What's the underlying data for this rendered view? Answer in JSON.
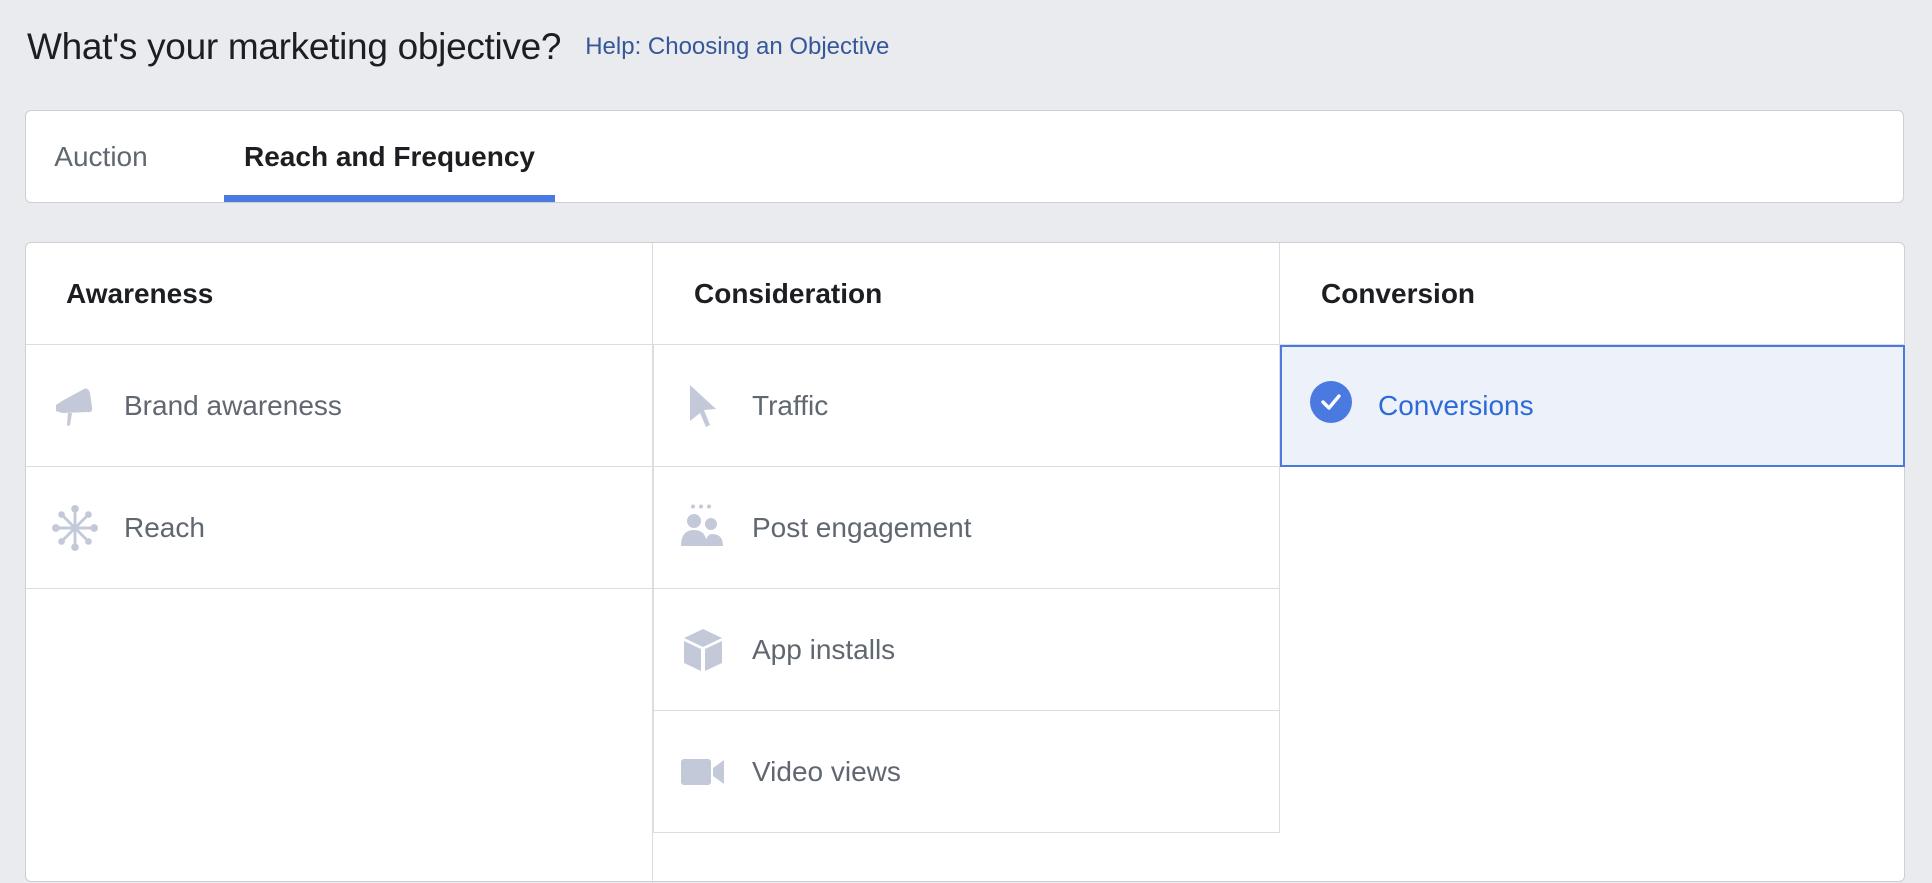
{
  "header": {
    "title": "What's your marketing objective?",
    "help_link": "Help: Choosing an Objective"
  },
  "tabs": [
    {
      "label": "Auction",
      "active": false
    },
    {
      "label": "Reach and Frequency",
      "active": true
    }
  ],
  "columns": [
    {
      "heading": "Awareness",
      "options": [
        {
          "label": "Brand awareness",
          "icon": "megaphone-icon"
        },
        {
          "label": "Reach",
          "icon": "reach-icon"
        }
      ]
    },
    {
      "heading": "Consideration",
      "options": [
        {
          "label": "Traffic",
          "icon": "cursor-icon"
        },
        {
          "label": "Post engagement",
          "icon": "people-icon"
        },
        {
          "label": "App installs",
          "icon": "box-icon"
        },
        {
          "label": "Video views",
          "icon": "video-camera-icon"
        }
      ]
    },
    {
      "heading": "Conversion",
      "options": [
        {
          "label": "Conversions",
          "icon": "check-circle-icon",
          "selected": true
        }
      ]
    }
  ],
  "colors": {
    "accent": "#4a7adf",
    "selected_bg": "#edf2fa",
    "icon": "#c3c9d8",
    "link": "#365899"
  }
}
